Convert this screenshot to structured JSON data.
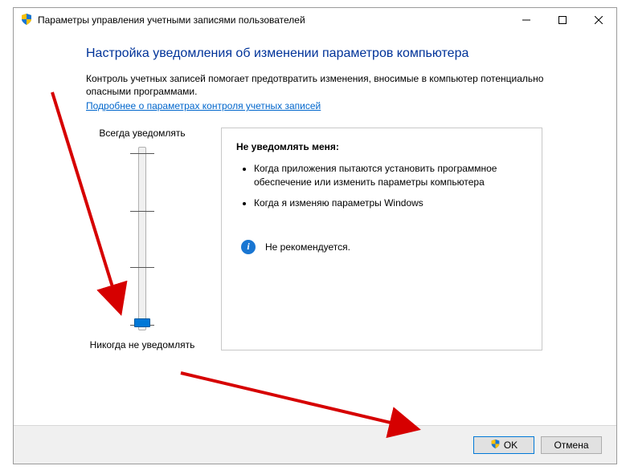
{
  "window": {
    "title": "Параметры управления учетными записями пользователей"
  },
  "heading": "Настройка уведомления об изменении параметров компьютера",
  "description": "Контроль учетных записей помогает предотвратить изменения, вносимые в компьютер потенциально опасными программами.",
  "link_text": "Подробнее о параметрах контроля учетных записей",
  "slider": {
    "top_label": "Всегда уведомлять",
    "bottom_label": "Никогда не уведомлять",
    "position": 0,
    "min": 0,
    "max": 3
  },
  "panel": {
    "title": "Не уведомлять меня:",
    "bullets": [
      "Когда приложения пытаются установить программное обеспечение или изменить параметры компьютера",
      "Когда я изменяю параметры Windows"
    ],
    "recommendation": "Не рекомендуется."
  },
  "footer": {
    "ok_label": "OK",
    "cancel_label": "Отмена"
  }
}
